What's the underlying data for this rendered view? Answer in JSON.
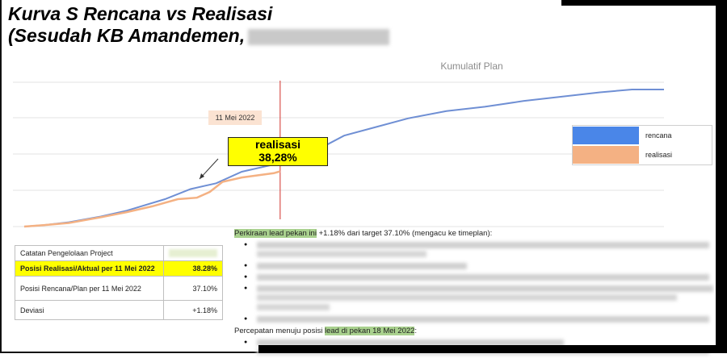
{
  "title": {
    "line1": "Kurva S Rencana vs Realisasi",
    "line2": "(Sesudah KB Amandemen,"
  },
  "chart_data": {
    "type": "line",
    "title": "Kumulatif Plan",
    "xlabel": "",
    "ylabel": "",
    "x_range": [
      0,
      100
    ],
    "ylim": [
      0,
      100
    ],
    "grid": true,
    "legend_placement": "right",
    "series": [
      {
        "name": "rencana",
        "color": "#6f8fd4",
        "x": [
          0,
          3,
          7,
          12,
          16,
          22,
          26,
          30,
          34,
          40,
          44,
          47,
          50,
          55,
          60,
          66,
          72,
          78,
          84,
          90,
          95,
          100
        ],
        "y": [
          0,
          1,
          3,
          7,
          11,
          19,
          26,
          30,
          38,
          44,
          52,
          56,
          63,
          69,
          75,
          80,
          83,
          87,
          90,
          93,
          95,
          95
        ]
      },
      {
        "name": "realisasi",
        "color": "#f4b183",
        "x": [
          0,
          3,
          7,
          12,
          16,
          20,
          24,
          27,
          29,
          31,
          34,
          39,
          40
        ],
        "y": [
          0,
          1,
          2.5,
          6.5,
          10,
          14,
          19,
          20,
          24,
          31,
          34,
          37,
          38.28
        ]
      }
    ],
    "marker_x": 40,
    "marker_label": "11 Mei 2022",
    "annotation": {
      "label": "realisasi",
      "value": "38,28%"
    }
  },
  "legend": {
    "items": [
      {
        "label": "rencana",
        "color": "#4a86e8"
      },
      {
        "label": "realisasi",
        "color": "#f4b183"
      }
    ]
  },
  "table": {
    "header": "Catatan Pengelolaan Project",
    "rows": [
      {
        "label": "Posisi Realisasi/Aktual per 11 Mei 2022",
        "value": "38.28%"
      },
      {
        "label": "Posisi Rencana/Plan per 11 Mei  2022",
        "value": "37.10%"
      },
      {
        "label": "Deviasi",
        "value": "+1.18%"
      }
    ]
  },
  "notes": {
    "line1_prefix": "Perkiraan lead pekan ini",
    "line1_rest": " +1.18% dari target 37.10% (mengacu ke timeplan):",
    "line2_prefix": "Percepatan menuju posisi ",
    "line2_highlight": "lead di pekan 18 Mei 2022",
    "line2_suffix": ":"
  }
}
